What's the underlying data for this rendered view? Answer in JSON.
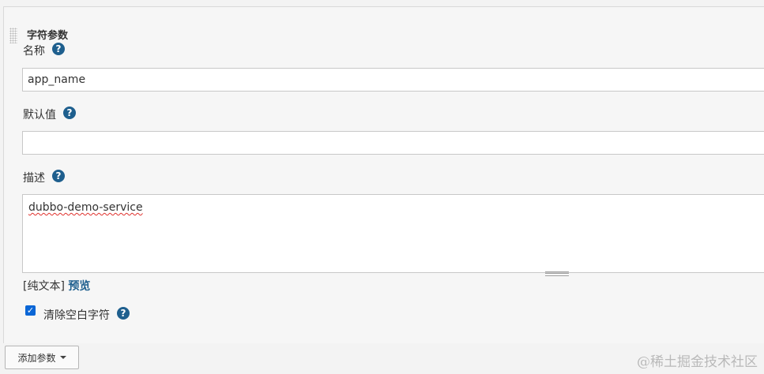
{
  "section": {
    "title": "字符参数"
  },
  "fields": {
    "name": {
      "label": "名称",
      "value": "app_name"
    },
    "default": {
      "label": "默认值",
      "value": ""
    },
    "description": {
      "label": "描述",
      "value": "dubbo-demo-service"
    }
  },
  "format": {
    "plain_text": "[纯文本]",
    "preview": "预览"
  },
  "trim": {
    "label": "清除空白字符",
    "checked": true
  },
  "help_glyph": "?",
  "add_button": {
    "label": "添加参数"
  },
  "watermark": "@稀土掘金技术社区",
  "colors": {
    "help_icon": "#1e5f8e",
    "link": "#1e5f8e",
    "checkbox": "#0a66d6"
  }
}
